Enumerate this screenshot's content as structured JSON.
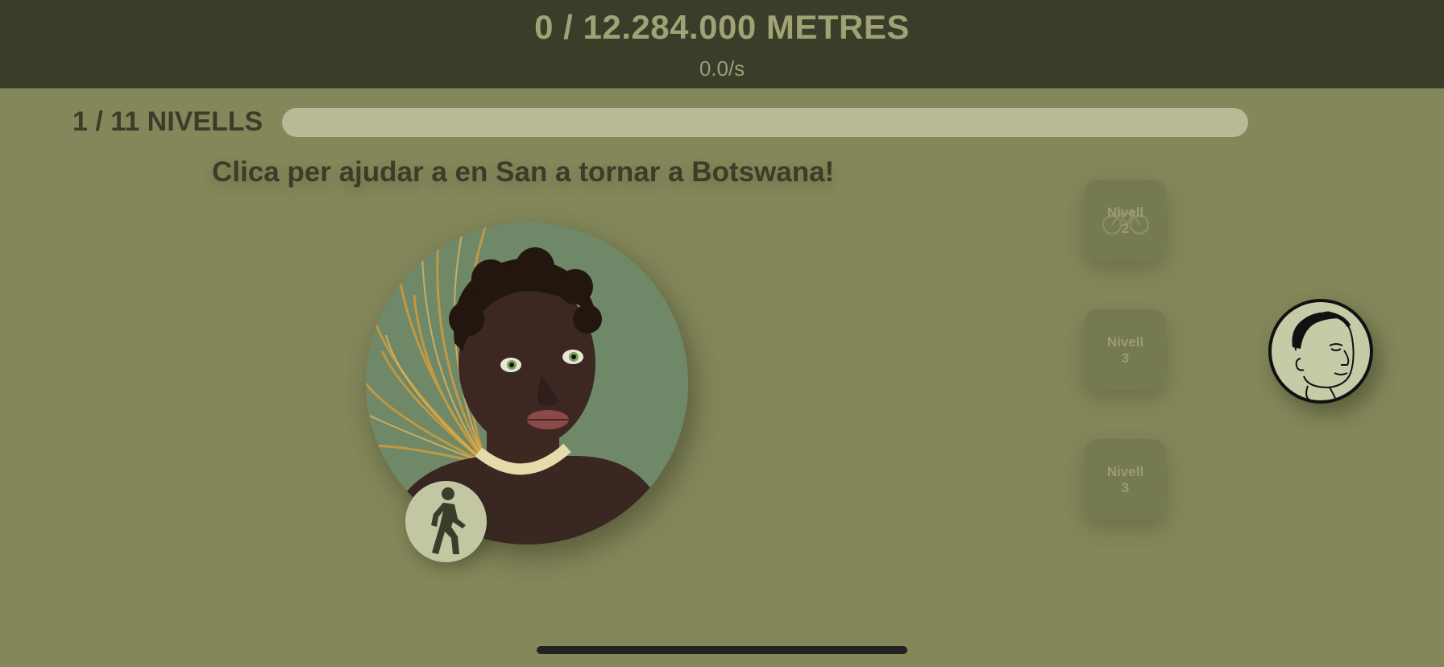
{
  "header": {
    "distance": "0 / 12.284.000 METRES",
    "rate": "0.0/s"
  },
  "progress": {
    "label": "1 / 11 NIVELLS",
    "fraction": 0.0
  },
  "instruction": "Clica per ajudar a en San a tornar a Botswana!",
  "character": {
    "portrait_icon": "san-portrait",
    "mode_icon": "walking-person-icon"
  },
  "levels": [
    {
      "line1": "Nivell",
      "line2": "2",
      "icon": "bicycle-icon"
    },
    {
      "line1": "Nivell",
      "line2": "3"
    },
    {
      "line1": "Nivell",
      "line2": "3"
    }
  ],
  "npc": {
    "icon": "man-sketch-portrait"
  },
  "colors": {
    "background": "#838759",
    "topbar": "#3a3d29",
    "progress_track": "#b7ba94",
    "text_dark": "#3b3d2a",
    "level_button": "#767a51"
  }
}
